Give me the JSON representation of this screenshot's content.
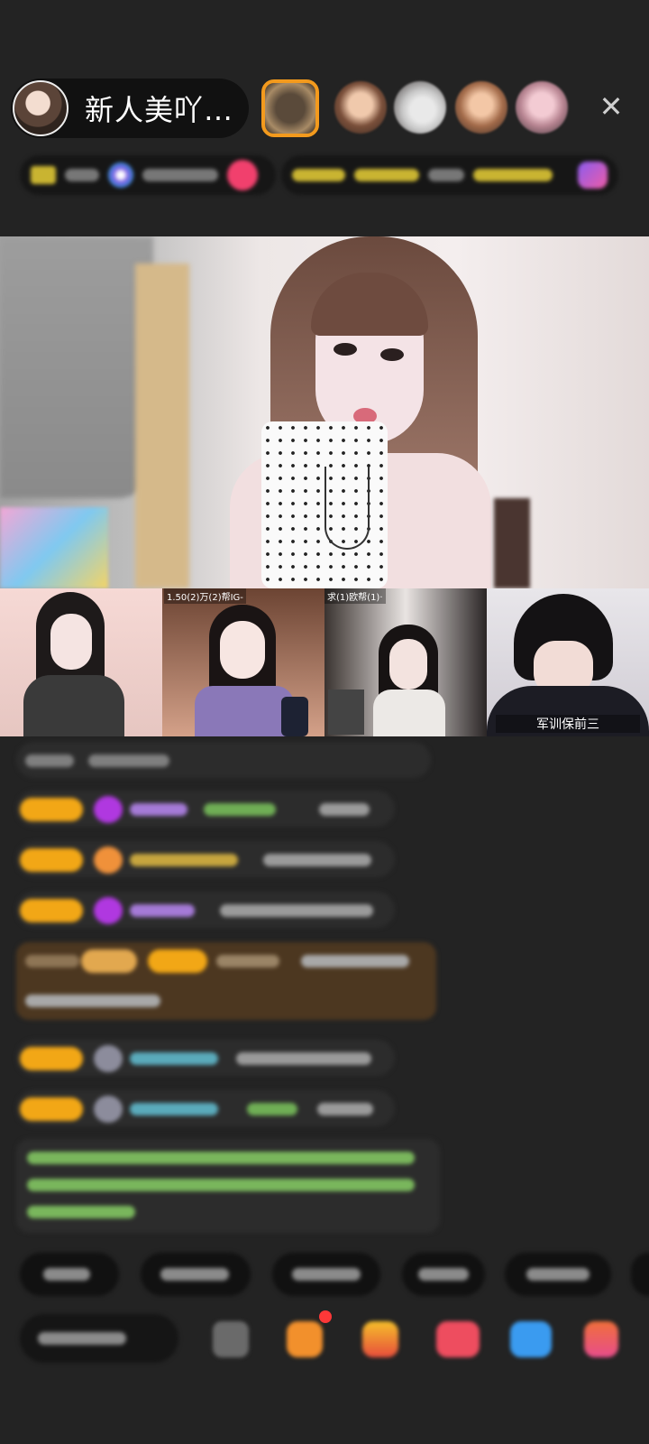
{
  "header": {
    "host_name": "新人美吖…",
    "close_glyph": "✕"
  },
  "tiles": [
    {
      "top_label": "",
      "name": ""
    },
    {
      "top_label": "1.50(2)万(2)帮IG-",
      "name": ""
    },
    {
      "top_label": "求(1)欧帮(1)·",
      "name": ""
    },
    {
      "top_label": "",
      "name": "军训保前三"
    }
  ],
  "colors": {
    "background": "#232323",
    "badge_orange": "#f2a716",
    "accent_pink": "#f1406d",
    "chat_green": "#7ecb62",
    "chat_cyan": "#58b9c9"
  },
  "icons": [
    "avatar",
    "close-icon",
    "gift-icon",
    "bag-icon",
    "more-icon"
  ]
}
